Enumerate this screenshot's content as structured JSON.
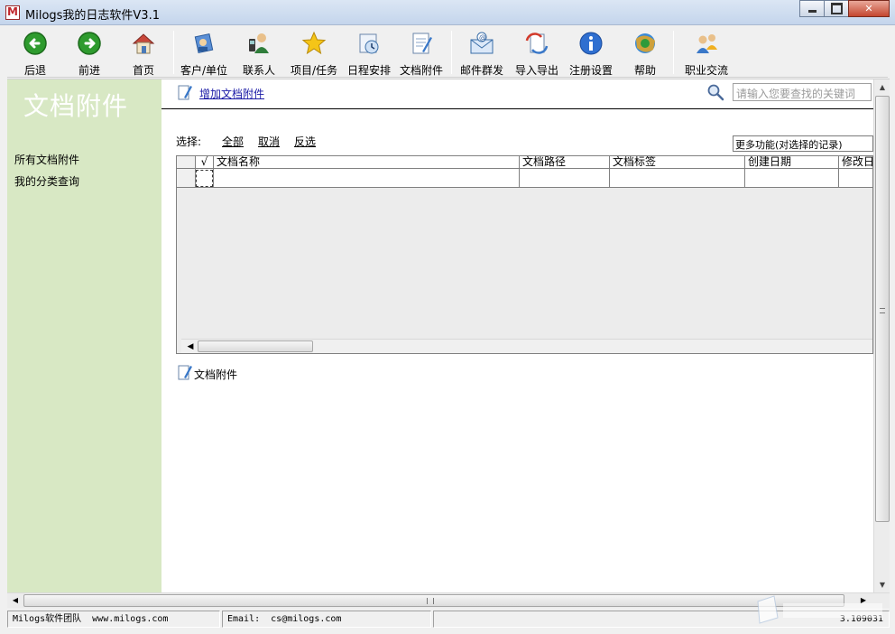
{
  "window": {
    "title": "Milogs我的日志软件V3.1"
  },
  "toolbar": {
    "items": [
      {
        "label": "后退",
        "icon": "back-arrow-icon"
      },
      {
        "label": "前进",
        "icon": "forward-arrow-icon"
      },
      {
        "label": "首页",
        "icon": "home-icon"
      },
      {
        "label": "客户/单位",
        "icon": "customer-icon"
      },
      {
        "label": "联系人",
        "icon": "contact-icon"
      },
      {
        "label": "项目/任务",
        "icon": "star-icon"
      },
      {
        "label": "日程安排",
        "icon": "calendar-icon"
      },
      {
        "label": "文档附件",
        "icon": "document-icon"
      },
      {
        "label": "邮件群发",
        "icon": "mail-icon"
      },
      {
        "label": "导入导出",
        "icon": "import-export-icon"
      },
      {
        "label": "注册设置",
        "icon": "info-icon"
      },
      {
        "label": "帮助",
        "icon": "help-icon"
      },
      {
        "label": "职业交流",
        "icon": "community-icon"
      }
    ]
  },
  "sidebar": {
    "title": "文档附件",
    "items": [
      {
        "label": "所有文档附件"
      },
      {
        "label": "我的分类查询"
      }
    ]
  },
  "content": {
    "add_link": "增加文档附件",
    "search_placeholder": "请输入您要查找的关键词",
    "select_label": "选择:",
    "select_all": "全部",
    "select_cancel": "取消",
    "select_invert": "反选",
    "more_functions": "更多功能(对选择的记录)",
    "grid": {
      "check_header": "√",
      "columns": [
        "文档名称",
        "文档路径",
        "文档标签",
        "创建日期",
        "修改日"
      ]
    },
    "section_caption": "文档附件"
  },
  "status": {
    "team": "Milogs软件团队  www.milogs.com",
    "email": "Email:  cs@milogs.com",
    "version": "3.109031"
  },
  "colors": {
    "sidebar_bg": "#d8e8c4",
    "link": "#1a1aa6"
  }
}
